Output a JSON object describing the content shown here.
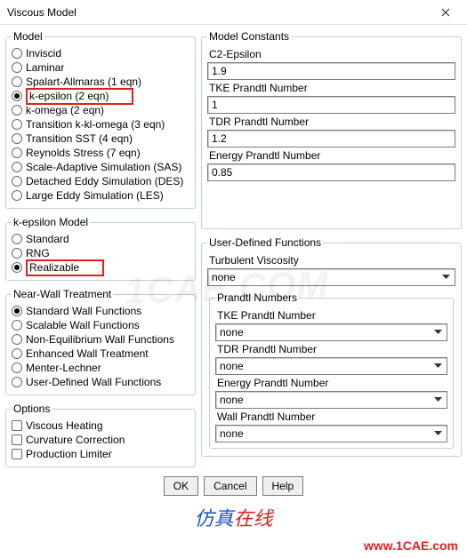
{
  "window": {
    "title": "Viscous Model"
  },
  "model": {
    "legend": "Model",
    "items": [
      {
        "label": "Inviscid",
        "selected": false
      },
      {
        "label": "Laminar",
        "selected": false
      },
      {
        "label": "Spalart-Allmaras (1 eqn)",
        "selected": false
      },
      {
        "label": "k-epsilon (2 eqn)",
        "selected": true,
        "highlight": true
      },
      {
        "label": "k-omega (2 eqn)",
        "selected": false
      },
      {
        "label": "Transition k-kl-omega (3 eqn)",
        "selected": false
      },
      {
        "label": "Transition SST (4 eqn)",
        "selected": false
      },
      {
        "label": "Reynolds Stress (7 eqn)",
        "selected": false
      },
      {
        "label": "Scale-Adaptive Simulation (SAS)",
        "selected": false
      },
      {
        "label": "Detached Eddy Simulation (DES)",
        "selected": false
      },
      {
        "label": "Large Eddy Simulation (LES)",
        "selected": false
      }
    ]
  },
  "keModel": {
    "legend": "k-epsilon Model",
    "items": [
      {
        "label": "Standard",
        "selected": false
      },
      {
        "label": "RNG",
        "selected": false
      },
      {
        "label": "Realizable",
        "selected": true,
        "highlight": true
      }
    ]
  },
  "nearWall": {
    "legend": "Near-Wall Treatment",
    "items": [
      {
        "label": "Standard Wall Functions",
        "selected": true
      },
      {
        "label": "Scalable Wall Functions",
        "selected": false
      },
      {
        "label": "Non-Equilibrium Wall Functions",
        "selected": false
      },
      {
        "label": "Enhanced Wall Treatment",
        "selected": false
      },
      {
        "label": "Menter-Lechner",
        "selected": false
      },
      {
        "label": "User-Defined Wall Functions",
        "selected": false
      }
    ]
  },
  "options": {
    "legend": "Options",
    "items": [
      {
        "label": "Viscous Heating"
      },
      {
        "label": "Curvature Correction"
      },
      {
        "label": "Production Limiter"
      }
    ]
  },
  "constants": {
    "legend": "Model Constants",
    "fields": [
      {
        "label": "C2-Epsilon",
        "value": "1.9"
      },
      {
        "label": "TKE Prandtl Number",
        "value": "1"
      },
      {
        "label": "TDR Prandtl Number",
        "value": "1.2"
      },
      {
        "label": "Energy Prandtl Number",
        "value": "0.85"
      }
    ]
  },
  "udf": {
    "legend": "User-Defined Functions",
    "turbVisc": {
      "label": "Turbulent Viscosity",
      "value": "none"
    },
    "prandtl": {
      "legend": "Prandtl Numbers",
      "fields": [
        {
          "label": "TKE Prandtl Number",
          "value": "none"
        },
        {
          "label": "TDR Prandtl Number",
          "value": "none"
        },
        {
          "label": "Energy Prandtl Number",
          "value": "none"
        },
        {
          "label": "Wall Prandtl Number",
          "value": "none"
        }
      ]
    }
  },
  "buttons": {
    "ok": "OK",
    "cancel": "Cancel",
    "help": "Help"
  },
  "watermark": "1CAE.COM",
  "footer": {
    "brand1": "仿真",
    "brand2": "在线",
    "url": "www.1CAE.com"
  }
}
